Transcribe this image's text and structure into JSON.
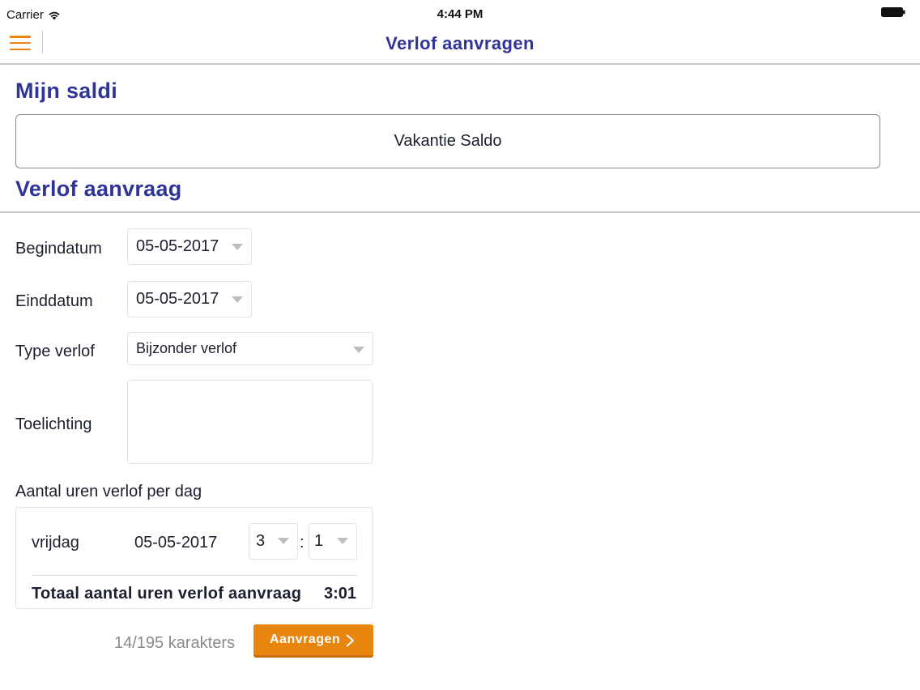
{
  "status_bar": {
    "carrier": "Carrier",
    "time": "4:44 PM"
  },
  "nav": {
    "title": "Verlof aanvragen"
  },
  "saldi": {
    "heading": "Mijn saldi",
    "box_label": "Vakantie Saldo"
  },
  "aanvraag": {
    "heading": "Verlof aanvraag"
  },
  "form": {
    "begindatum": {
      "label": "Begindatum",
      "value": "05-05-2017"
    },
    "einddatum": {
      "label": "Einddatum",
      "value": "05-05-2017"
    },
    "type": {
      "label": "Type verlof",
      "value": "Bijzonder verlof"
    },
    "toelichting": {
      "label": "Toelichting",
      "value": ""
    }
  },
  "hours": {
    "heading": "Aantal uren verlof per dag",
    "day": "vrijdag",
    "date": "05-05-2017",
    "hours": "3",
    "separator": ":",
    "minutes": "1",
    "total_label": "Totaal aantal uren verlof aanvraag",
    "total_value": "3:01"
  },
  "footer": {
    "counter": "14/195 karakters",
    "submit_label": "Aanvragen"
  },
  "colors": {
    "accent": "#e8850f",
    "brand_blue": "#2f3596"
  },
  "icons": [
    "wifi-icon",
    "battery-icon",
    "menu-icon",
    "dropdown-arrow-icon",
    "chevron-right-icon"
  ]
}
